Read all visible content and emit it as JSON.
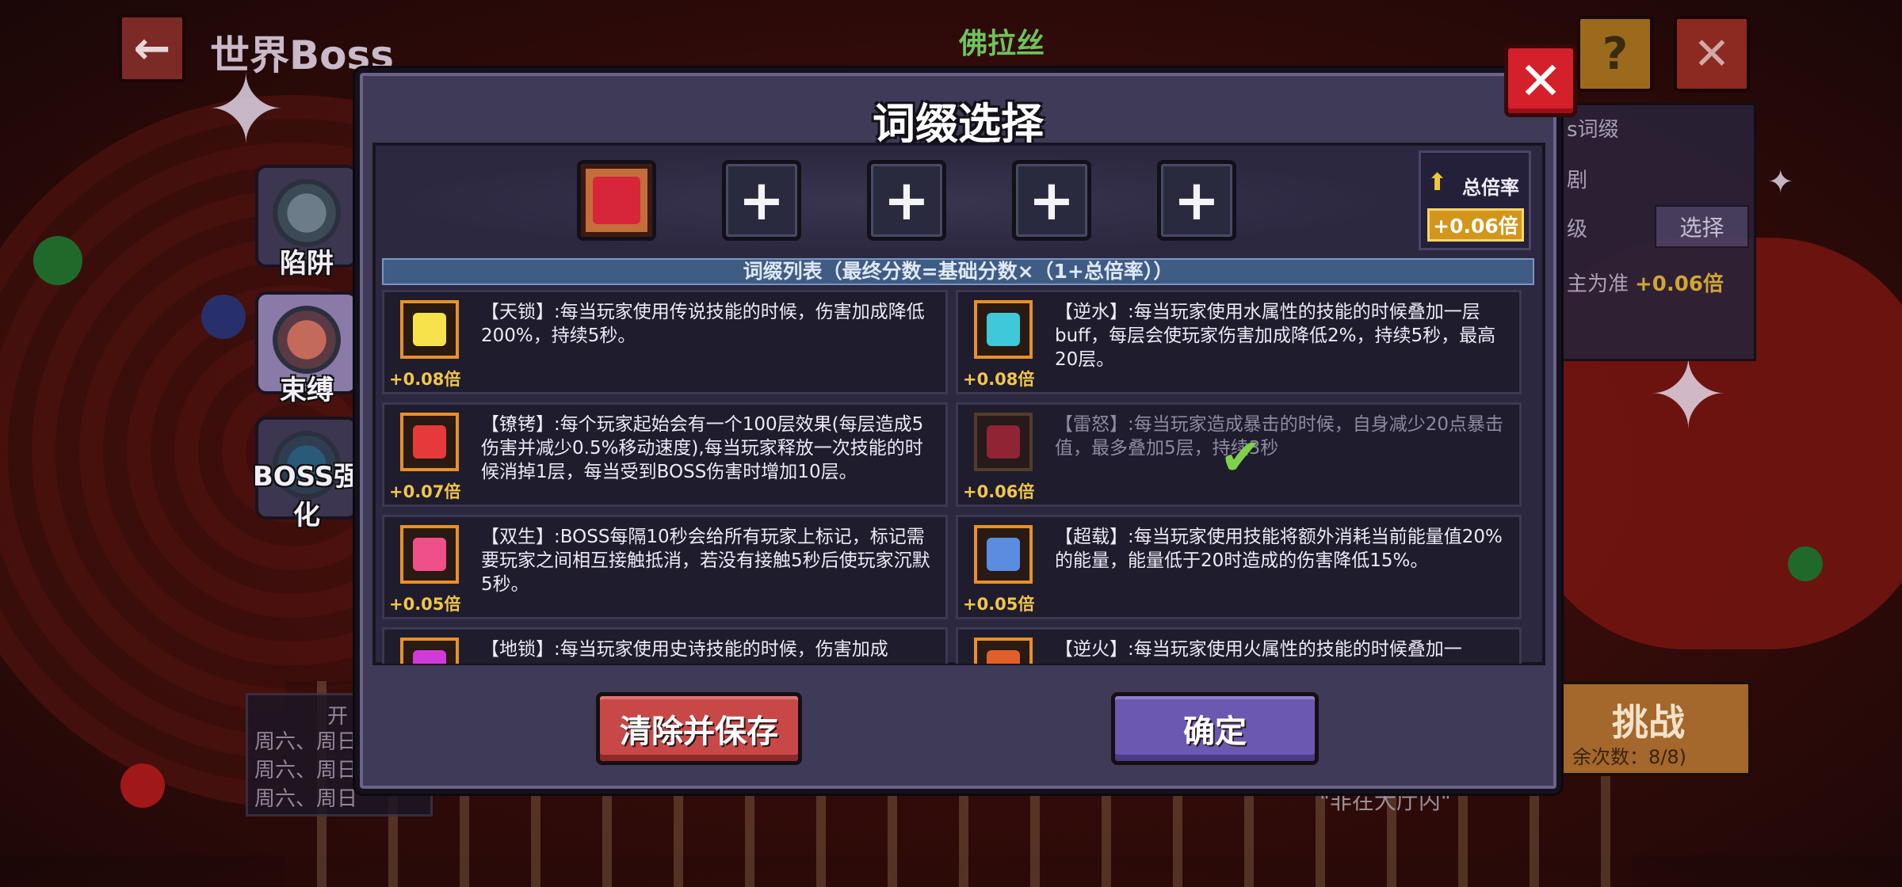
{
  "header": {
    "back_icon": "arrow-left-icon",
    "title": "世界Boss",
    "boss_name": "佛拉丝",
    "help_label": "?",
    "close_label": "✕"
  },
  "sidebar": {
    "items": [
      {
        "label": "陷阱",
        "icon": "trap-gear-icon"
      },
      {
        "label": "束缚",
        "icon": "bind-gear-icon"
      },
      {
        "label": "BOSS强化",
        "icon": "boss-boost-gear-icon"
      }
    ]
  },
  "right_panel": {
    "row1": "s词缀",
    "row2": "剧",
    "row3": "级",
    "select_label": "选择",
    "row4": "主为准",
    "boost": "+0.06倍"
  },
  "challenge": {
    "label": "挑战",
    "sub": "余次数：8/8)"
  },
  "schedule": {
    "title": "开",
    "lines": [
      "周六、周日",
      "周六、周日",
      "周六、周日"
    ]
  },
  "bottom_caption": "\"非在大厅内\"",
  "dialog": {
    "title": "词缀选择",
    "close_label": "✕",
    "slots": [
      {
        "state": "filled",
        "icon": "thunder-anger-icon"
      },
      {
        "state": "empty",
        "label": "+"
      },
      {
        "state": "empty",
        "label": "+"
      },
      {
        "state": "empty",
        "label": "+"
      },
      {
        "state": "empty",
        "label": "+"
      }
    ],
    "total": {
      "label": "总倍率",
      "value": "+0.06倍",
      "icon": "arrow-up-icon"
    },
    "list_header": "词缀列表（最终分数=基础分数×（1+总倍率））",
    "affixes": [
      {
        "desc": "【天锁】:每当玩家使用传说技能的时候，伤害加成降低200%，持续5秒。",
        "mult": "+0.08倍",
        "icon": "sky-lock-icon",
        "color": "#f6e24a",
        "selected": false
      },
      {
        "desc": "【逆水】:每当玩家使用水属性的技能的时候叠加一层buff，每层会使玩家伤害加成降低2%，持续5秒，最高20层。",
        "mult": "+0.08倍",
        "icon": "reverse-water-icon",
        "color": "#3ec8d8",
        "selected": false
      },
      {
        "desc": "【镣铐】:每个玩家起始会有一个100层效果(每层造成5伤害并减少0.5%移动速度),每当玩家释放一次技能的时候消掉1层，每当受到BOSS伤害时增加10层。",
        "mult": "+0.07倍",
        "icon": "shackle-icon",
        "color": "#e63a3a",
        "selected": false
      },
      {
        "desc": "【雷怒】:每当玩家造成暴击的时候，自身减少20点暴击值，最多叠加5层，持续3秒",
        "mult": "+0.06倍",
        "icon": "thunder-anger-icon",
        "color": "#c02838",
        "selected": true
      },
      {
        "desc": "【双生】:BOSS每隔10秒会给所有玩家上标记，标记需要玩家之间相互接触抵消，若没有接触5秒后使玩家沉默5秒。",
        "mult": "+0.05倍",
        "icon": "twin-heart-icon",
        "color": "#f0508a",
        "selected": false
      },
      {
        "desc": "【超载】:每当玩家使用技能将额外消耗当前能量值20%的能量，能量低于20时造成的伤害降低15%。",
        "mult": "+0.05倍",
        "icon": "overload-icon",
        "color": "#5a8ce0",
        "selected": false
      },
      {
        "desc": "【地锁】:每当玩家使用史诗技能的时候，伤害加成",
        "mult": "",
        "icon": "earth-lock-icon",
        "color": "#d23ad8",
        "selected": false
      },
      {
        "desc": "【逆火】:每当玩家使用火属性的技能的时候叠加一",
        "mult": "",
        "icon": "reverse-fire-icon",
        "color": "#e0602a",
        "selected": false
      }
    ],
    "buttons": {
      "clear_save": "清除并保存",
      "confirm": "确定"
    }
  }
}
